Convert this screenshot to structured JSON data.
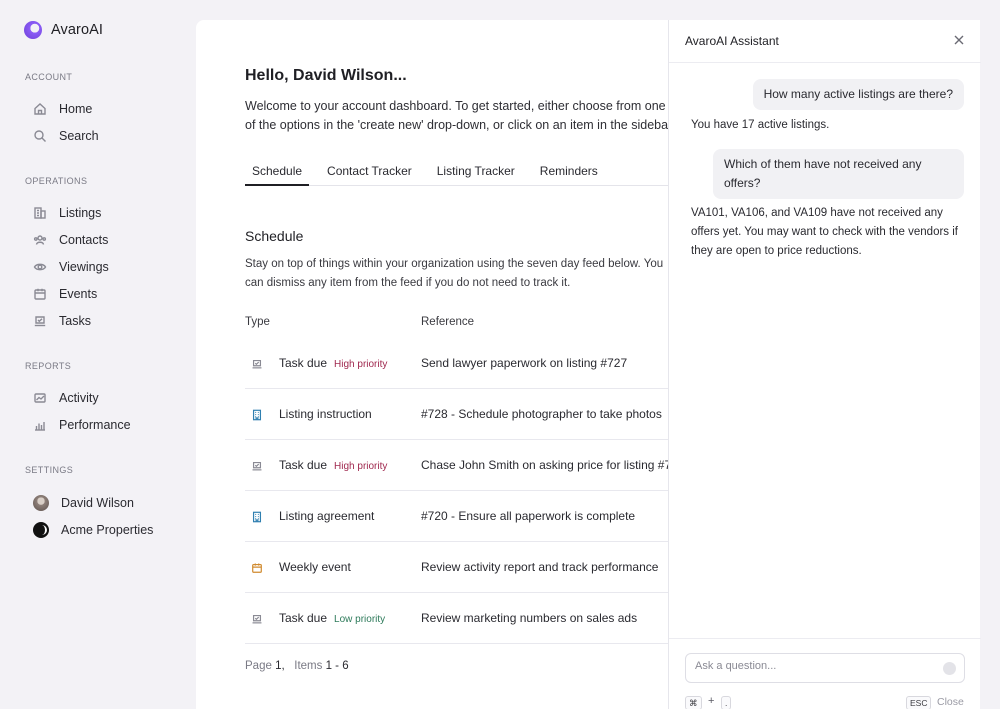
{
  "app": {
    "name": "AvaroAI"
  },
  "sidebar": {
    "sections": {
      "account": "ACCOUNT",
      "operations": "OPERATIONS",
      "reports": "REPORTS",
      "settings": "SETTINGS"
    },
    "items": {
      "home": "Home",
      "search": "Search",
      "listings": "Listings",
      "contacts": "Contacts",
      "viewings": "Viewings",
      "events": "Events",
      "tasks": "Tasks",
      "activity": "Activity",
      "performance": "Performance",
      "user": "David Wilson",
      "org": "Acme Properties"
    }
  },
  "main": {
    "greeting": "Hello, David Wilson...",
    "welcome_line1": "Welcome to your account dashboard. To get started, either choose from one",
    "welcome_line2": "of the options in the 'create new' drop-down, or click on an item in the sidebar.",
    "tabs": [
      "Schedule",
      "Contact Tracker",
      "Listing Tracker",
      "Reminders"
    ],
    "schedule_title": "Schedule",
    "schedule_desc": "Stay on top of things within your organization using the seven day feed below. You can dismiss any item from the feed if you do not need to track it.",
    "columns": {
      "type": "Type",
      "reference": "Reference"
    },
    "rows": [
      {
        "icon": "task-icon",
        "type": "Task due",
        "priority": "High priority",
        "reference": "Send lawyer paperwork on listing #727"
      },
      {
        "icon": "building-icon",
        "type": "Listing instruction",
        "priority": "",
        "reference": "#728 - Schedule photographer to take photos"
      },
      {
        "icon": "task-icon",
        "type": "Task due",
        "priority": "High priority",
        "reference": "Chase John Smith on asking price for listing #7"
      },
      {
        "icon": "building-icon",
        "type": "Listing agreement",
        "priority": "",
        "reference": "#720 - Ensure all paperwork is complete"
      },
      {
        "icon": "calendar-icon",
        "type": "Weekly event",
        "priority": "",
        "reference": "Review activity report and track performance"
      },
      {
        "icon": "task-icon",
        "type": "Task due",
        "priority": "Low priority",
        "reference": "Review marketing numbers on sales ads"
      }
    ],
    "pager": {
      "page_label": "Page",
      "page": "1,",
      "items_label": "Items",
      "items": "1 - 6"
    }
  },
  "assistant": {
    "title": "AvaroAI Assistant",
    "messages": {
      "q1": "How many active listings are there?",
      "a1": "You have 17 active listings.",
      "q2": "Which of them have not received any offers?",
      "a2": "VA101, VA106, and VA109 have not received any offers yet. You may want to check with the vendors if they are open to price reductions."
    },
    "input_placeholder": "Ask a question...",
    "shortcut": {
      "cmd": "⌘",
      "plus": "+",
      "dot": ".",
      "esc": "ESC",
      "close": "Close"
    }
  },
  "colors": {
    "background": "#f3f2f6",
    "brand": "#7c4ddb",
    "high_priority": "#a0294f",
    "low_priority": "#2d7a5a"
  }
}
